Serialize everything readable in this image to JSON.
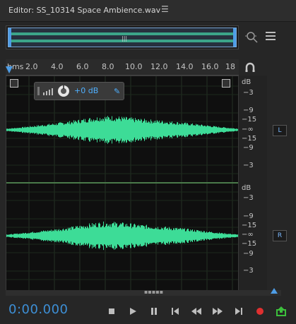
{
  "editor": {
    "title": "Editor: SS_10314 Space Ambience.wav",
    "menu_icon": "hamburger-icon"
  },
  "overview": {
    "grip": "|||"
  },
  "ruler": {
    "unit": "hms",
    "ticks": [
      "2.0",
      "4.0",
      "6.0",
      "8.0",
      "10.0",
      "12.0",
      "14.0",
      "16.0",
      "18"
    ]
  },
  "hud": {
    "volume": "+0 dB"
  },
  "db_scale": {
    "left": [
      "dB",
      "−3",
      "−9",
      "−15",
      "−∞",
      "−15",
      "−9",
      "−3"
    ],
    "right": [
      "dB",
      "−3",
      "−9",
      "−15",
      "−∞",
      "−15",
      "−9",
      "−3"
    ]
  },
  "channels": {
    "left": "L",
    "right": "R"
  },
  "transport": {
    "time": "0:00.000"
  },
  "colors": {
    "waveform": "#3ddc97",
    "accent": "#4e9de6",
    "record": "#e03030",
    "output": "#3cbf3c"
  }
}
